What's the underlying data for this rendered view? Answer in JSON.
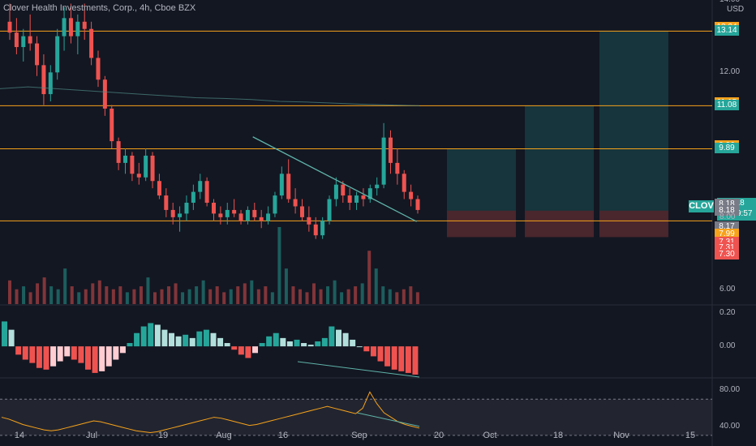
{
  "title": "Clover Health Investments, Corp., 4h, Cboe BZX",
  "ticker": "CLOV",
  "currency": "USD",
  "last_price": "8.18",
  "countdown": "02:09:57",
  "colors": {
    "up": "#26a69a",
    "down": "#ef5350",
    "orange": "#f7a21b",
    "bg": "#131722",
    "grid": "#1e222d"
  },
  "price_labels": [
    {
      "text": "13.24",
      "color": "#f7a21b",
      "price": 13.24
    },
    {
      "text": "13.14",
      "color": "#26a69a",
      "price": 13.14
    },
    {
      "text": "11.15",
      "color": "#f7a21b",
      "price": 11.15
    },
    {
      "text": "11.08",
      "color": "#26a69a",
      "price": 11.08
    },
    {
      "text": "9.96",
      "color": "#f7a21b",
      "price": 9.96
    },
    {
      "text": "9.89",
      "color": "#26a69a",
      "price": 9.89
    },
    {
      "text": "8.18",
      "color": "#787b86",
      "price": 8.35
    },
    {
      "text": "8.18",
      "color": "#787b86",
      "price": 8.18
    },
    {
      "text": "8.17",
      "color": "#787b86",
      "price": 7.72
    },
    {
      "text": "7.99",
      "color": "#f7a21b",
      "price": 7.52
    },
    {
      "text": "7.31",
      "color": "#ef5350",
      "price": 7.31
    },
    {
      "text": "7.31",
      "color": "#ef5350",
      "price": 7.14
    },
    {
      "text": "7.30",
      "color": "#ef5350",
      "price": 6.97
    }
  ],
  "chart_data": {
    "type": "candlestick",
    "price_axis": {
      "ticks": [
        "14.00",
        "12.00",
        "8.00",
        "6.00"
      ],
      "ylim": [
        5.6,
        14.0
      ]
    },
    "x_axis": {
      "ticks": [
        "14",
        "Jul",
        "19",
        "Aug",
        "16",
        "Sep",
        "20",
        "Oct",
        "18",
        "Nov",
        "15"
      ]
    },
    "horizontal_levels": [
      13.14,
      11.08,
      9.89,
      7.9
    ],
    "ohlc": [
      {
        "o": 13.4,
        "h": 13.9,
        "l": 12.9,
        "c": 13.1
      },
      {
        "o": 13.1,
        "h": 13.5,
        "l": 12.5,
        "c": 12.7
      },
      {
        "o": 12.7,
        "h": 13.2,
        "l": 12.3,
        "c": 13.0
      },
      {
        "o": 13.0,
        "h": 13.6,
        "l": 12.6,
        "c": 12.8
      },
      {
        "o": 12.8,
        "h": 13.0,
        "l": 11.9,
        "c": 12.2
      },
      {
        "o": 12.2,
        "h": 12.5,
        "l": 11.1,
        "c": 11.4
      },
      {
        "o": 11.4,
        "h": 12.2,
        "l": 11.2,
        "c": 12.0
      },
      {
        "o": 12.0,
        "h": 13.2,
        "l": 11.8,
        "c": 13.0
      },
      {
        "o": 13.0,
        "h": 13.8,
        "l": 12.6,
        "c": 13.5
      },
      {
        "o": 13.5,
        "h": 13.9,
        "l": 12.8,
        "c": 13.0
      },
      {
        "o": 13.0,
        "h": 13.6,
        "l": 12.5,
        "c": 13.4
      },
      {
        "o": 13.4,
        "h": 13.9,
        "l": 12.9,
        "c": 13.2
      },
      {
        "o": 13.2,
        "h": 13.4,
        "l": 12.2,
        "c": 12.4
      },
      {
        "o": 12.4,
        "h": 12.6,
        "l": 11.6,
        "c": 11.8
      },
      {
        "o": 11.8,
        "h": 11.9,
        "l": 10.8,
        "c": 11.0
      },
      {
        "o": 11.0,
        "h": 11.1,
        "l": 9.9,
        "c": 10.1
      },
      {
        "o": 10.1,
        "h": 10.2,
        "l": 9.3,
        "c": 9.5
      },
      {
        "o": 9.5,
        "h": 9.9,
        "l": 9.2,
        "c": 9.7
      },
      {
        "o": 9.7,
        "h": 9.8,
        "l": 9.0,
        "c": 9.2
      },
      {
        "o": 9.2,
        "h": 9.5,
        "l": 8.9,
        "c": 9.1
      },
      {
        "o": 9.1,
        "h": 9.9,
        "l": 9.0,
        "c": 9.7
      },
      {
        "o": 9.7,
        "h": 9.8,
        "l": 8.8,
        "c": 9.0
      },
      {
        "o": 9.0,
        "h": 9.2,
        "l": 8.5,
        "c": 8.6
      },
      {
        "o": 8.6,
        "h": 8.8,
        "l": 8.0,
        "c": 8.2
      },
      {
        "o": 8.2,
        "h": 8.4,
        "l": 7.8,
        "c": 8.0
      },
      {
        "o": 8.0,
        "h": 8.3,
        "l": 7.6,
        "c": 8.1
      },
      {
        "o": 8.1,
        "h": 8.6,
        "l": 7.9,
        "c": 8.4
      },
      {
        "o": 8.4,
        "h": 8.9,
        "l": 8.2,
        "c": 8.7
      },
      {
        "o": 8.7,
        "h": 9.2,
        "l": 8.5,
        "c": 9.0
      },
      {
        "o": 9.0,
        "h": 9.1,
        "l": 8.3,
        "c": 8.4
      },
      {
        "o": 8.4,
        "h": 8.5,
        "l": 7.9,
        "c": 8.1
      },
      {
        "o": 8.1,
        "h": 8.3,
        "l": 7.8,
        "c": 8.0
      },
      {
        "o": 8.0,
        "h": 8.4,
        "l": 7.8,
        "c": 8.2
      },
      {
        "o": 8.2,
        "h": 8.5,
        "l": 8.0,
        "c": 8.1
      },
      {
        "o": 8.1,
        "h": 8.2,
        "l": 7.8,
        "c": 7.9
      },
      {
        "o": 7.9,
        "h": 8.3,
        "l": 7.8,
        "c": 8.2
      },
      {
        "o": 8.2,
        "h": 8.4,
        "l": 7.9,
        "c": 8.0
      },
      {
        "o": 8.0,
        "h": 8.2,
        "l": 7.7,
        "c": 7.9
      },
      {
        "o": 7.9,
        "h": 8.3,
        "l": 7.8,
        "c": 8.1
      },
      {
        "o": 8.1,
        "h": 8.7,
        "l": 8.0,
        "c": 8.6
      },
      {
        "o": 8.6,
        "h": 9.4,
        "l": 8.5,
        "c": 9.2
      },
      {
        "o": 9.2,
        "h": 9.6,
        "l": 8.4,
        "c": 8.5
      },
      {
        "o": 8.5,
        "h": 8.8,
        "l": 8.1,
        "c": 8.3
      },
      {
        "o": 8.3,
        "h": 8.5,
        "l": 7.9,
        "c": 8.0
      },
      {
        "o": 8.0,
        "h": 8.3,
        "l": 7.6,
        "c": 7.8
      },
      {
        "o": 7.8,
        "h": 8.0,
        "l": 7.4,
        "c": 7.5
      },
      {
        "o": 7.5,
        "h": 8.0,
        "l": 7.4,
        "c": 7.9
      },
      {
        "o": 7.9,
        "h": 8.6,
        "l": 7.8,
        "c": 8.5
      },
      {
        "o": 8.5,
        "h": 9.1,
        "l": 8.3,
        "c": 8.9
      },
      {
        "o": 8.9,
        "h": 9.0,
        "l": 8.4,
        "c": 8.6
      },
      {
        "o": 8.6,
        "h": 8.8,
        "l": 8.2,
        "c": 8.4
      },
      {
        "o": 8.4,
        "h": 8.7,
        "l": 8.2,
        "c": 8.6
      },
      {
        "o": 8.6,
        "h": 8.8,
        "l": 8.3,
        "c": 8.5
      },
      {
        "o": 8.5,
        "h": 8.9,
        "l": 8.4,
        "c": 8.8
      },
      {
        "o": 8.8,
        "h": 9.1,
        "l": 8.6,
        "c": 8.9
      },
      {
        "o": 8.9,
        "h": 10.6,
        "l": 8.8,
        "c": 10.2
      },
      {
        "o": 10.2,
        "h": 10.4,
        "l": 9.2,
        "c": 9.5
      },
      {
        "o": 9.5,
        "h": 9.9,
        "l": 8.9,
        "c": 9.2
      },
      {
        "o": 9.2,
        "h": 9.3,
        "l": 8.5,
        "c": 8.7
      },
      {
        "o": 8.7,
        "h": 8.9,
        "l": 8.3,
        "c": 8.5
      },
      {
        "o": 8.5,
        "h": 8.6,
        "l": 8.1,
        "c": 8.2
      }
    ],
    "moving_average": [
      11.55,
      11.6,
      11.55,
      11.5,
      11.45,
      11.4,
      11.35,
      11.3,
      11.28,
      11.25,
      11.2,
      11.18,
      11.15,
      11.12,
      11.1,
      11.08
    ],
    "trendline": {
      "from": [
        0.355,
        10.22
      ],
      "to": [
        0.585,
        7.88
      ]
    },
    "position_boxes": [
      {
        "target": 9.89,
        "stop": 7.45
      },
      {
        "target": 11.08,
        "stop": 7.45
      },
      {
        "target": 13.14,
        "stop": 7.45
      }
    ],
    "volume": [
      40,
      25,
      30,
      20,
      35,
      45,
      30,
      25,
      60,
      30,
      20,
      25,
      35,
      40,
      30,
      25,
      30,
      20,
      25,
      30,
      45,
      20,
      25,
      30,
      35,
      20,
      25,
      30,
      40,
      25,
      30,
      20,
      25,
      30,
      35,
      40,
      25,
      30,
      20,
      130,
      60,
      30,
      25,
      20,
      35,
      25,
      30,
      40,
      20,
      25,
      30,
      35,
      90,
      60,
      30,
      25,
      20,
      25,
      30,
      20
    ],
    "macd": {
      "ticks": [
        "0.20",
        "0.00"
      ],
      "ylim": [
        -0.18,
        0.23
      ],
      "hist": [
        0.15,
        0.1,
        -0.05,
        -0.08,
        -0.1,
        -0.13,
        -0.14,
        -0.12,
        -0.09,
        -0.06,
        -0.08,
        -0.1,
        -0.14,
        -0.16,
        -0.15,
        -0.12,
        -0.08,
        -0.04,
        0.02,
        0.08,
        0.12,
        0.14,
        0.13,
        0.1,
        0.08,
        0.06,
        0.07,
        0.05,
        0.09,
        0.1,
        0.08,
        0.05,
        0.02,
        -0.02,
        -0.05,
        -0.07,
        -0.04,
        0.02,
        0.06,
        0.08,
        0.05,
        0.03,
        0.04,
        0.02,
        0.01,
        0.03,
        0.05,
        0.12,
        0.1,
        0.08,
        0.04,
        0.0,
        -0.03,
        -0.06,
        -0.09,
        -0.12,
        -0.14,
        -0.15,
        -0.16,
        -0.17
      ]
    },
    "rsi": {
      "ticks": [
        "80.00",
        "40.00"
      ],
      "ylim": [
        20,
        90
      ],
      "band": [
        30,
        70
      ],
      "values": [
        50,
        48,
        45,
        42,
        40,
        38,
        36,
        35,
        36,
        38,
        40,
        42,
        44,
        46,
        45,
        43,
        41,
        39,
        37,
        35,
        34,
        33,
        34,
        36,
        38,
        40,
        42,
        44,
        46,
        48,
        50,
        49,
        47,
        45,
        43,
        41,
        42,
        44,
        46,
        48,
        50,
        52,
        54,
        56,
        58,
        60,
        62,
        60,
        58,
        56,
        54,
        60,
        78,
        65,
        55,
        50,
        45,
        42,
        40,
        38
      ]
    }
  }
}
